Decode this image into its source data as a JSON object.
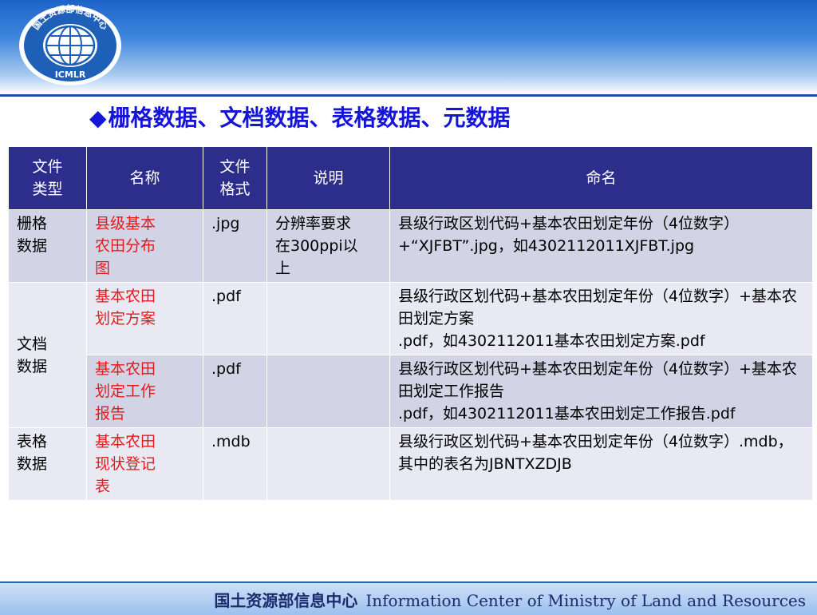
{
  "header": {
    "logo_text_top": "国土资源部信息中心",
    "logo_text_bottom": "ICMLR",
    "colors": {
      "band_top": "#1d62c9",
      "band_rule": "#1f4fa8",
      "title": "#1515d8"
    }
  },
  "slide": {
    "bullet": "◆",
    "title": "栅格数据、文档数据、表格数据、元数据"
  },
  "table": {
    "headers": [
      "文件\n类型",
      "名称",
      "文件\n格式",
      "说明",
      "命名"
    ],
    "rows": [
      {
        "type": "栅格\n数据",
        "name": "县级基本\n农田分布\n图",
        "format": ".jpg",
        "note": "分辨率要求\n在300ppi以\n上",
        "naming": "县级行政区划代码+基本农田划定年份（4位数字）+“XJFBT”.jpg，如4302112011XJFBT.jpg"
      },
      {
        "type": "文档\n数据",
        "name": "基本农田\n划定方案",
        "format": ".pdf",
        "note": "",
        "naming": "县级行政区划代码+基本农田划定年份（4位数字）+基本农田划定方案\n.pdf，如4302112011基本农田划定方案.pdf"
      },
      {
        "type": "",
        "name": "基本农田\n划定工作\n报告",
        "format": ".pdf",
        "note": "",
        "naming": "县级行政区划代码+基本农田划定年份（4位数字）+基本农田划定工作报告\n.pdf，如4302112011基本农田划定工作报告.pdf"
      },
      {
        "type": "表格\n数据",
        "name": "基本农田\n现状登记\n表",
        "format": ".mdb",
        "note": "",
        "naming": "县级行政区划代码+基本农田划定年份（4位数字）.mdb，其中的表名为JBNTXZDJB"
      }
    ],
    "colors": {
      "header_bg": "#2d2d8c",
      "row_shaded": "#d3d3e6",
      "row_light": "#e9e9f3",
      "name_text": "#e31a1a"
    }
  },
  "footer": {
    "cn": "国土资源部信息中心",
    "en": "Information Center of Ministry of Land and Resources"
  }
}
